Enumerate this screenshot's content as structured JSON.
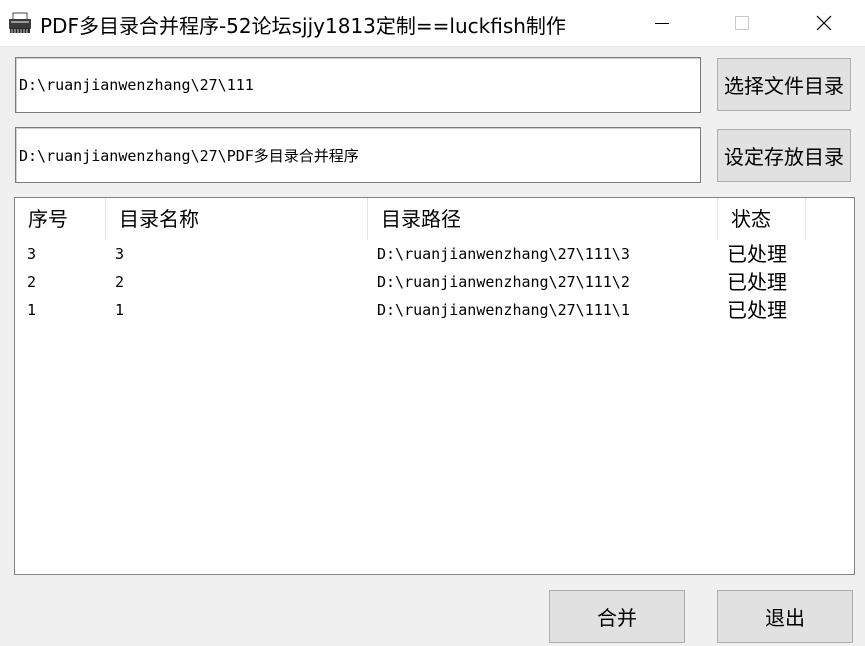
{
  "window": {
    "title": "PDF多目录合并程序-52论坛sjjy1813定制==luckfish制作"
  },
  "source": {
    "path_value": "D:\\ruanjianwenzhang\\27\\111",
    "button_label": "选择文件目录"
  },
  "output": {
    "path_value": "D:\\ruanjianwenzhang\\27\\PDF多目录合并程序",
    "button_label": "设定存放目录"
  },
  "table": {
    "columns": [
      "序号",
      "目录名称",
      "目录路径",
      "状态"
    ],
    "rows": [
      {
        "index": "3",
        "name": "3",
        "path": "D:\\ruanjianwenzhang\\27\\111\\3",
        "status": "已处理"
      },
      {
        "index": "2",
        "name": "2",
        "path": "D:\\ruanjianwenzhang\\27\\111\\2",
        "status": "已处理"
      },
      {
        "index": "1",
        "name": "1",
        "path": "D:\\ruanjianwenzhang\\27\\111\\1",
        "status": "已处理"
      }
    ]
  },
  "actions": {
    "merge_label": "合并",
    "exit_label": "退出"
  },
  "icons": {
    "app": "printer-icon",
    "minimize": "minimize-icon",
    "maximize": "maximize-icon",
    "close": "close-icon"
  }
}
